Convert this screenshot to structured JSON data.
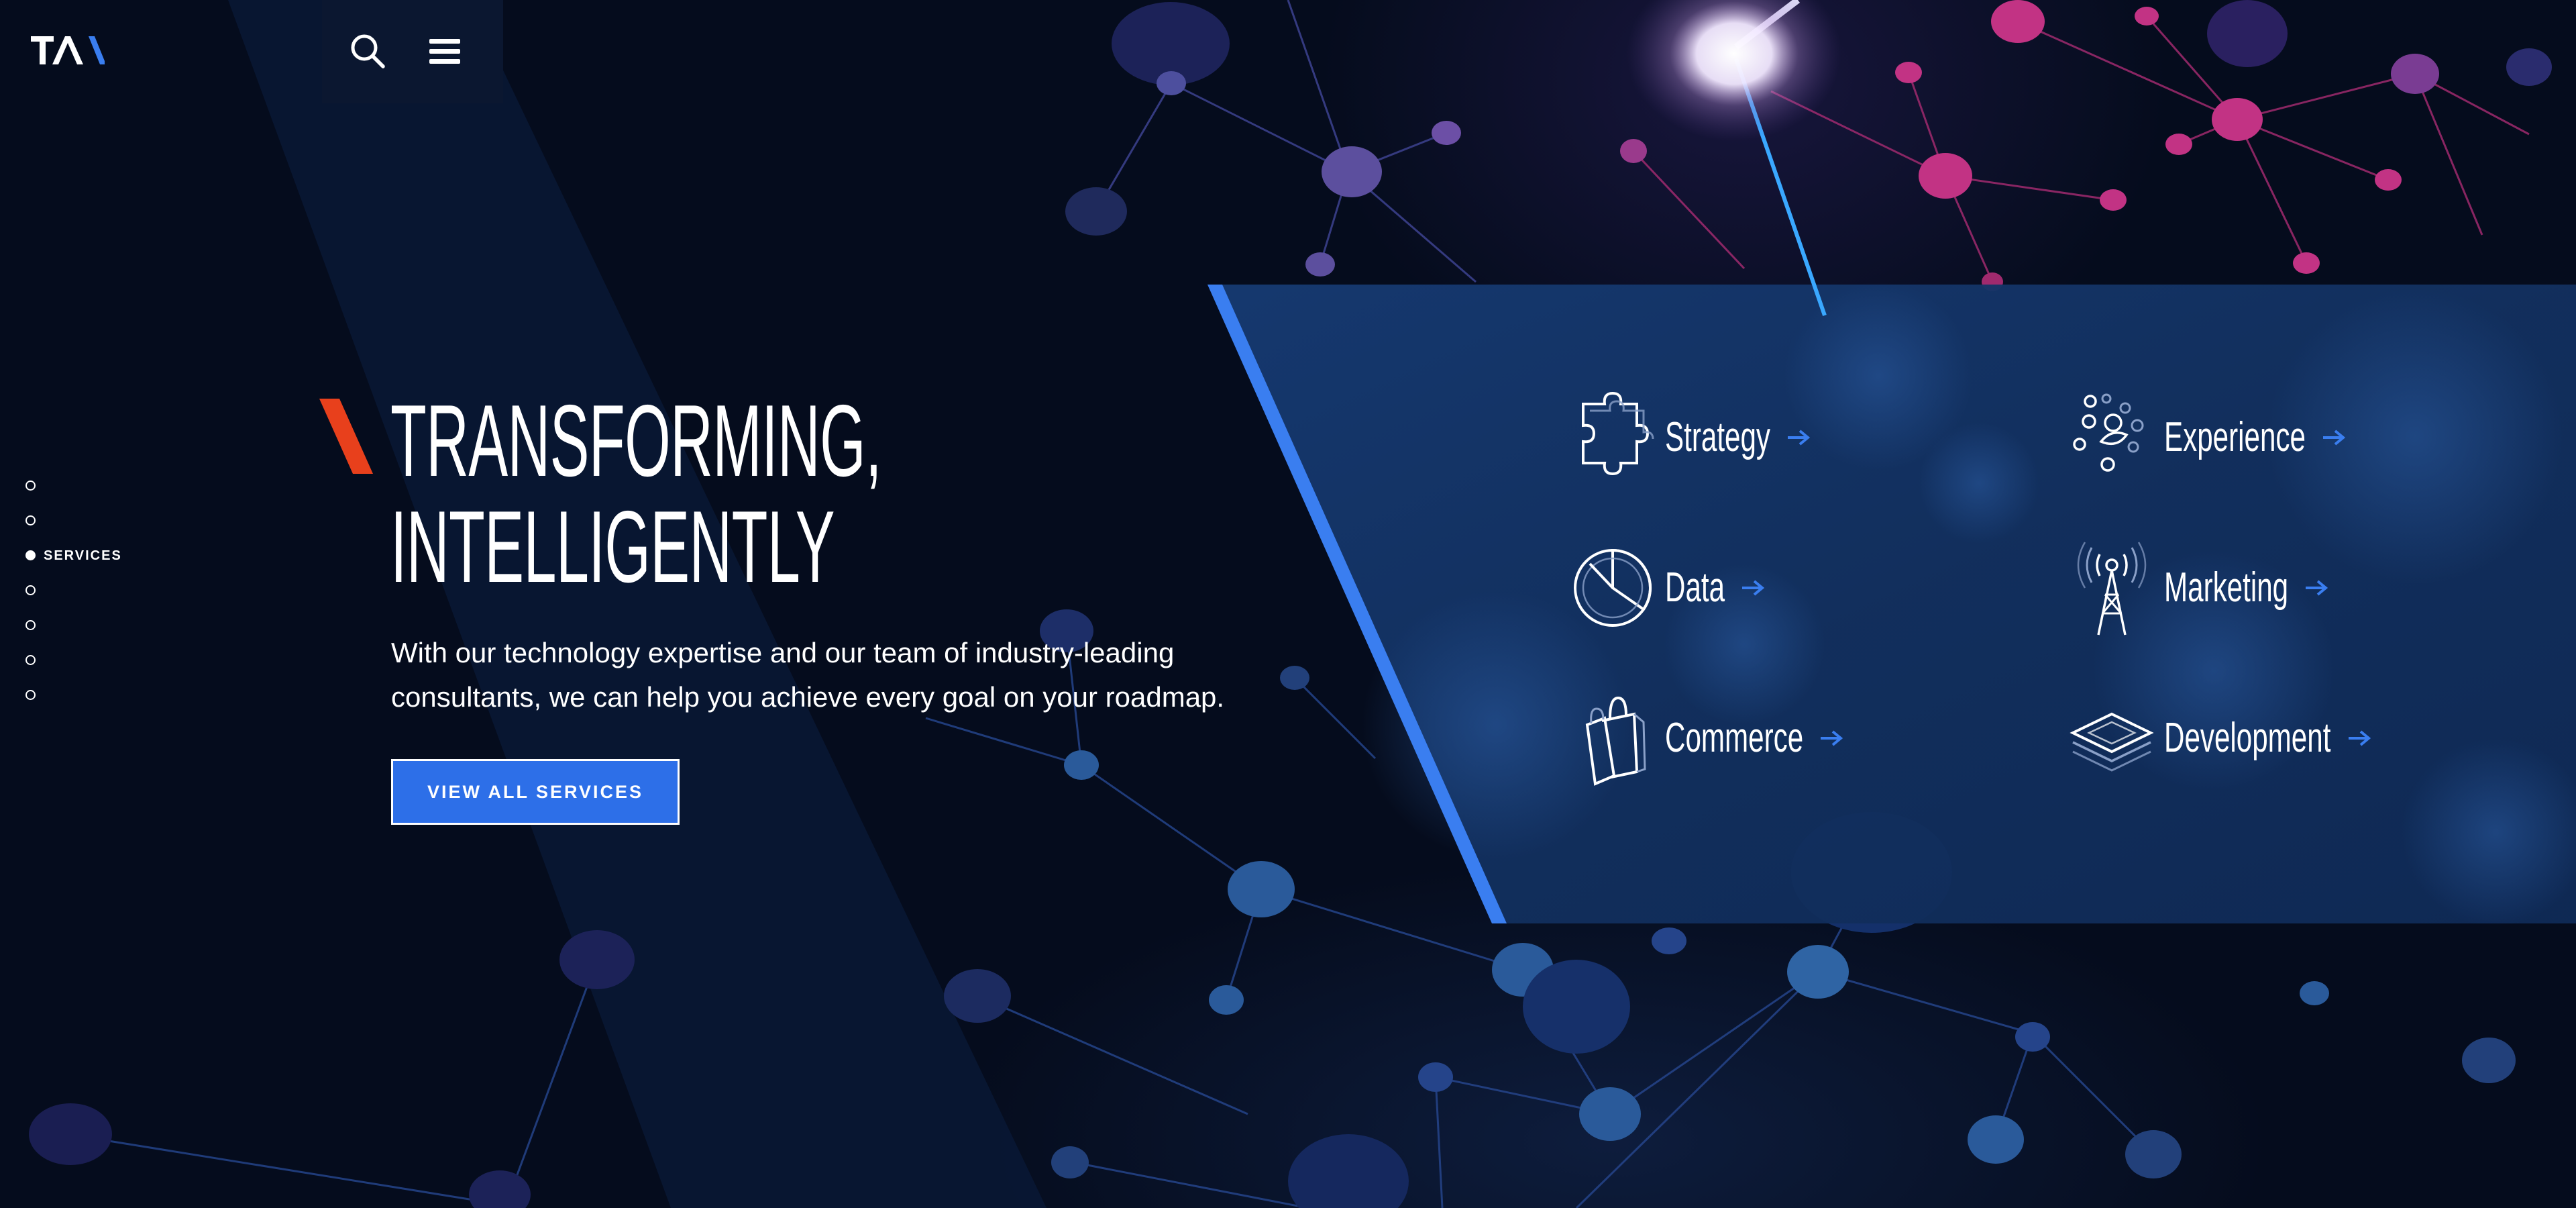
{
  "header": {
    "logo_text": "TA"
  },
  "side_nav": {
    "items": [
      {
        "label": "",
        "active": false
      },
      {
        "label": "",
        "active": false
      },
      {
        "label": "SERVICES",
        "active": true
      },
      {
        "label": "",
        "active": false
      },
      {
        "label": "",
        "active": false
      },
      {
        "label": "",
        "active": false
      },
      {
        "label": "",
        "active": false
      }
    ]
  },
  "hero": {
    "title_line1": "TRANSFORMING,",
    "title_line2": "INTELLIGENTLY",
    "description": "With our technology expertise and our team of industry-leading consultants, we can help you achieve every goal on your roadmap.",
    "cta_label": "VIEW ALL SERVICES"
  },
  "services": [
    {
      "label": "Strategy",
      "icon": "puzzle-icon"
    },
    {
      "label": "Experience",
      "icon": "experience-dots-icon"
    },
    {
      "label": "Data",
      "icon": "pie-chart-icon"
    },
    {
      "label": "Marketing",
      "icon": "broadcast-tower-icon"
    },
    {
      "label": "Commerce",
      "icon": "shopping-bags-icon"
    },
    {
      "label": "Development",
      "icon": "layers-icon"
    }
  ],
  "colors": {
    "background": "#050c1d",
    "accent_blue": "#2d6fe8",
    "accent_red": "#e8401c",
    "panel_blue": "#153466",
    "node_pink": "#c23384"
  }
}
